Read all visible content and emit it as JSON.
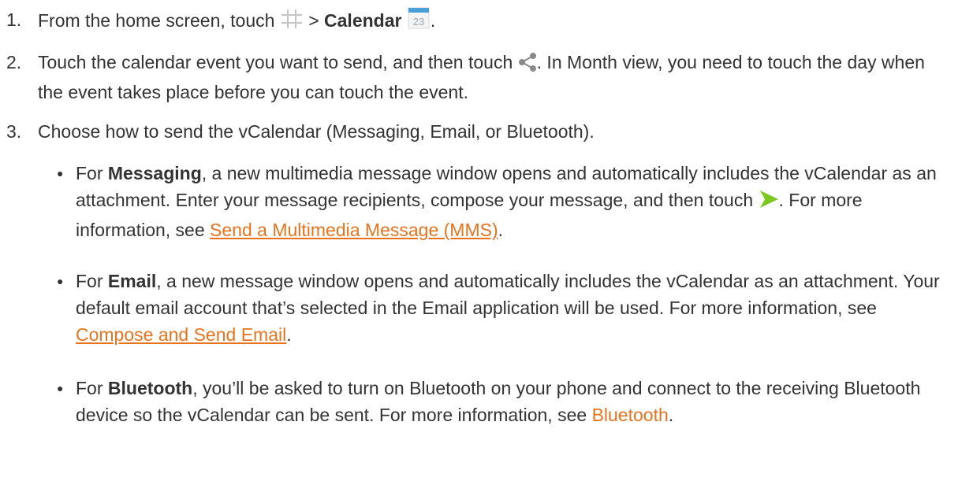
{
  "steps": [
    {
      "num": "1.",
      "pre": "From the home screen, touch",
      "sep": ">",
      "bold": "Calendar",
      "calendar_icon_text": "23",
      "post": "."
    },
    {
      "num": "2.",
      "pre": "Touch the calendar event you want to send, and then touch",
      "post": ". In Month view, you need to touch the day when the event takes place before you can touch the event."
    },
    {
      "num": "3.",
      "text": "Choose how to send the vCalendar (Messaging, Email, or Bluetooth)."
    }
  ],
  "bullets": [
    {
      "dot": "●",
      "pre": "For",
      "bold": "Messaging",
      "mid": ", a new multimedia message window opens and automatically includes the vCalendar as an attachment. Enter your message recipients, compose your message, and then touch",
      "mid2": ". For more information, see",
      "link": "Send a Multimedia Message (MMS)",
      "post": "."
    },
    {
      "dot": "●",
      "pre": "For",
      "bold": "Email",
      "mid": ", a new message window opens and automatically includes the vCalendar as an attachment. Your default email account that’s selected in the Email application will be used. For more information, see",
      "link": "Compose and Send Email",
      "post": "."
    },
    {
      "dot": "●",
      "pre": "For",
      "bold": "Bluetooth",
      "mid": ", you’ll be asked to turn on Bluetooth on your phone and connect to the receiving Bluetooth device so the vCalendar can be sent. For more information, see",
      "link": "Bluetooth",
      "post": "."
    }
  ],
  "icons": {
    "apps": "apps-grid-icon",
    "calendar": "calendar-icon",
    "share": "share-icon",
    "send": "send-icon"
  },
  "colors": {
    "text": "#333333",
    "link": "#e8731c",
    "send_icon": "#7cc820",
    "calendar_top": "#4a9fd8"
  }
}
